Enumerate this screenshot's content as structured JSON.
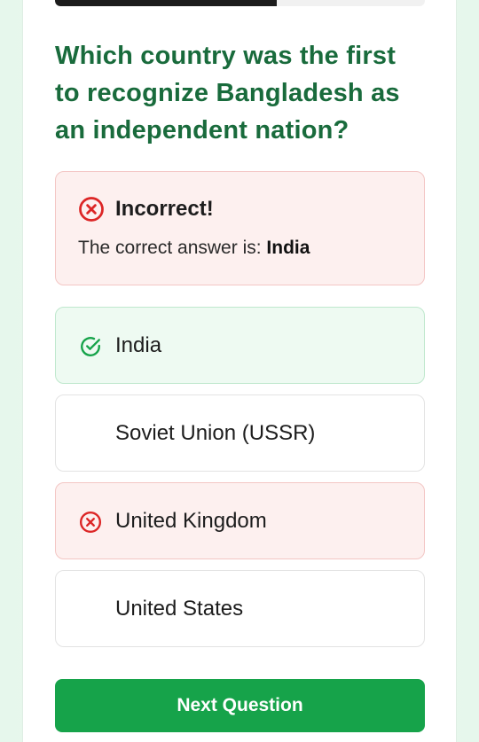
{
  "progress": {
    "fraction": 0.6
  },
  "question": {
    "text": "Which country was the first to recognize Bangladesh as an independent nation?"
  },
  "feedback": {
    "title": "Incorrect!",
    "text_prefix": "The correct answer is: ",
    "correct_answer": "India",
    "icon": "x-circle-icon"
  },
  "options": [
    {
      "label": "India",
      "state": "correct",
      "icon": "check-circle-icon"
    },
    {
      "label": "Soviet Union (USSR)",
      "state": "neutral",
      "icon": ""
    },
    {
      "label": "United Kingdom",
      "state": "wrong",
      "icon": "x-circle-icon"
    },
    {
      "label": "United States",
      "state": "neutral",
      "icon": ""
    }
  ],
  "next_button": {
    "label": "Next Question"
  },
  "colors": {
    "accent_green": "#16a34a",
    "question_green": "#196b3c",
    "error_red": "#dc2626",
    "success_green": "#16a34a"
  }
}
